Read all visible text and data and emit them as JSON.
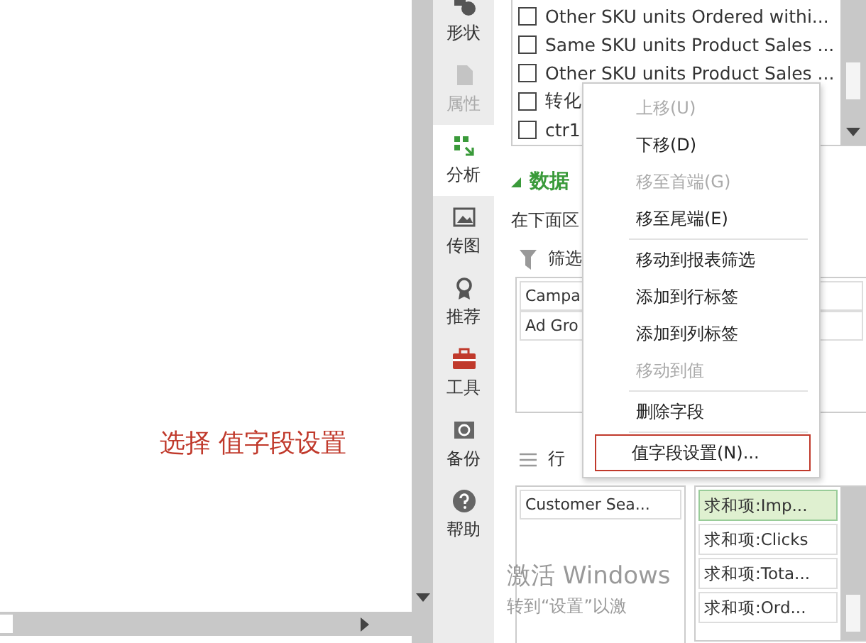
{
  "canvas": {
    "note": "选择 值字段设置"
  },
  "sidebar": {
    "items": [
      {
        "label": "形状",
        "kind": "shape",
        "selected": false,
        "disabled": false
      },
      {
        "label": "属性",
        "kind": "props",
        "selected": false,
        "disabled": true
      },
      {
        "label": "分析",
        "kind": "analyze",
        "selected": true,
        "disabled": false
      },
      {
        "label": "传图",
        "kind": "image",
        "selected": false,
        "disabled": false
      },
      {
        "label": "推荐",
        "kind": "award",
        "selected": false,
        "disabled": false
      },
      {
        "label": "工具",
        "kind": "toolbox",
        "selected": false,
        "disabled": false
      },
      {
        "label": "备份",
        "kind": "backup",
        "selected": false,
        "disabled": false
      },
      {
        "label": "帮助",
        "kind": "help",
        "selected": false,
        "disabled": false
      }
    ]
  },
  "field_list": {
    "items": [
      {
        "label": "Other SKU units Ordered withi...",
        "checked": false
      },
      {
        "label": "Same SKU units Product Sales ...",
        "checked": false
      },
      {
        "label": "Other SKU units Product Sales ...",
        "checked": false
      },
      {
        "label": "转化",
        "checked": false
      },
      {
        "label": "ctr1",
        "checked": false
      }
    ]
  },
  "section_title": "数据",
  "hint": "在下面区",
  "filters": {
    "label": "筛选",
    "items": [
      "Campa",
      "Ad Gro"
    ]
  },
  "rows": {
    "label": "行",
    "items": [
      "Customer Sea..."
    ]
  },
  "values": {
    "items": [
      {
        "label": "求和项:Imp...",
        "selected": true
      },
      {
        "label": "求和项:Clicks",
        "selected": false
      },
      {
        "label": "求和项:Tota...",
        "selected": false
      },
      {
        "label": "求和项:Ord...",
        "selected": false
      }
    ]
  },
  "context_menu": {
    "items": [
      {
        "kind": "item",
        "label": "上移(U)",
        "disabled": true,
        "highlighted": false
      },
      {
        "kind": "item",
        "label": "下移(D)",
        "disabled": false,
        "highlighted": false
      },
      {
        "kind": "item",
        "label": "移至首端(G)",
        "disabled": true,
        "highlighted": false
      },
      {
        "kind": "item",
        "label": "移至尾端(E)",
        "disabled": false,
        "highlighted": false
      },
      {
        "kind": "separator"
      },
      {
        "kind": "item",
        "label": "移动到报表筛选",
        "disabled": false,
        "highlighted": false
      },
      {
        "kind": "item",
        "label": "添加到行标签",
        "disabled": false,
        "highlighted": false
      },
      {
        "kind": "item",
        "label": "添加到列标签",
        "disabled": false,
        "highlighted": false
      },
      {
        "kind": "item",
        "label": "移动到值",
        "disabled": true,
        "highlighted": false
      },
      {
        "kind": "separator"
      },
      {
        "kind": "item",
        "label": "删除字段",
        "disabled": false,
        "highlighted": false
      },
      {
        "kind": "separator"
      },
      {
        "kind": "item",
        "label": "值字段设置(N)...",
        "disabled": false,
        "highlighted": true
      }
    ]
  },
  "activation": {
    "title": "激活 Windows",
    "subtitle": "转到“设置”以激"
  }
}
